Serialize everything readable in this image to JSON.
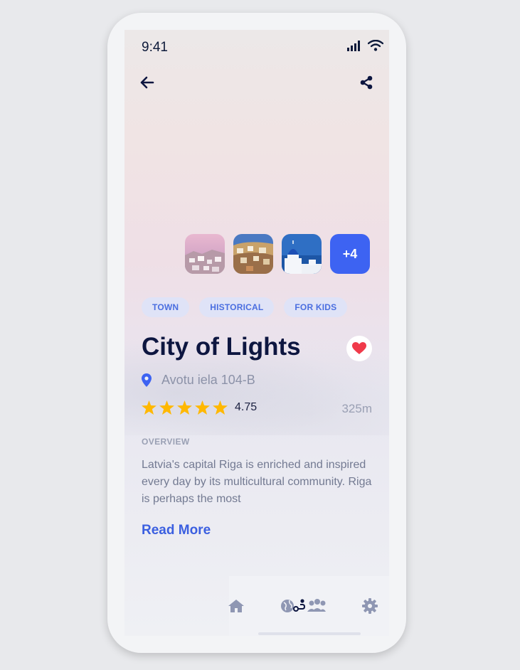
{
  "status_bar": {
    "time": "9:41"
  },
  "icons": {
    "back": "arrow-left-icon",
    "share": "share-icon",
    "signal": "cellular-signal-icon",
    "wifi": "wifi-icon",
    "battery": "battery-icon",
    "favorite": "heart-icon",
    "location": "map-pin-icon",
    "star": "star-icon",
    "nav": [
      "home-icon",
      "globe-route-icon",
      "users-icon",
      "gear-icon"
    ]
  },
  "gallery": {
    "more_count": "+4"
  },
  "tags": [
    "TOWN",
    "HISTORICAL",
    "FOR KIDS"
  ],
  "place": {
    "title": "City of Lights",
    "address": "Avotu iela 104-B",
    "rating": "4.75",
    "stars_filled": 5,
    "distance": "325m"
  },
  "overview": {
    "heading": "OVERVIEW",
    "text": "Latvia's capital Riga is enriched and inspired every day by its multicultural community. Riga is perhaps the most",
    "read_more": "Read More"
  },
  "colors": {
    "accent": "#3d63f2",
    "title": "#0d1640",
    "heart": "#f03a4a",
    "star": "#ffb800",
    "tag_bg": "#dfe3f7"
  }
}
